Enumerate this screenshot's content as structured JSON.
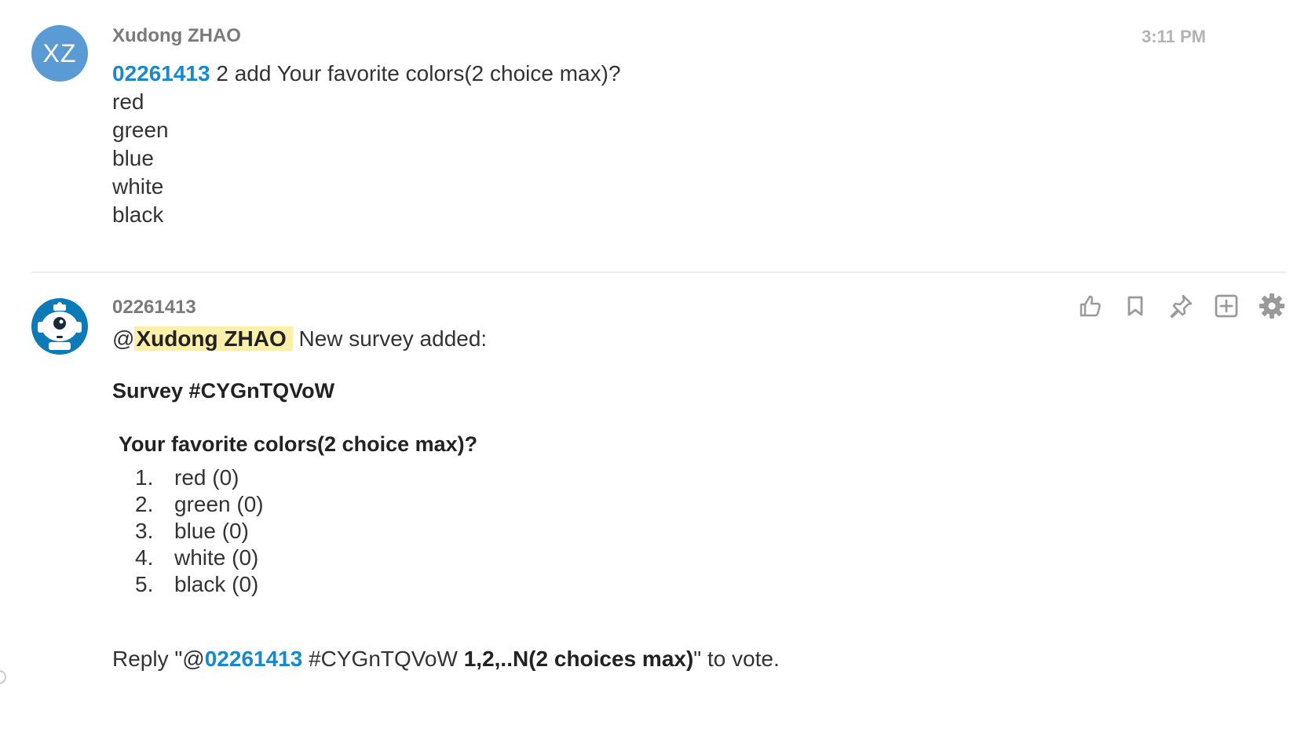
{
  "messages": [
    {
      "avatar_initials": "XZ",
      "sender": "Xudong ZHAO",
      "timestamp": "3:11 PM",
      "mention": "02261413",
      "command_text": " 2 add Your favorite colors(2 choice max)?",
      "lines": [
        "red",
        "green",
        "blue",
        "white",
        "black"
      ]
    },
    {
      "sender": "02261413",
      "reply_prefix": "@",
      "mentioned_user": "Xudong ZHAO",
      "reply_text": " New survey added:",
      "survey_id": "Survey #CYGnTQVoW",
      "question": "Your favorite colors(2 choice max)?",
      "options": [
        {
          "num": "1.",
          "label": "red (0)"
        },
        {
          "num": "2.",
          "label": "green (0)"
        },
        {
          "num": "3.",
          "label": "blue (0)"
        },
        {
          "num": "4.",
          "label": "white (0)"
        },
        {
          "num": "5.",
          "label": "black (0)"
        }
      ],
      "vote": {
        "prefix": "Reply \"@",
        "mention": "02261413",
        "survey_tag": " #CYGnTQVoW ",
        "choices": "1,2,..N(2 choices max)",
        "suffix": "\" to vote."
      }
    }
  ],
  "actions": [
    "thumbs-up-icon",
    "bookmark-icon",
    "pin-icon",
    "add-square-icon",
    "gear-icon"
  ],
  "colors": {
    "link": "#1a88c9",
    "mention_highlight": "#fbefaa",
    "avatar_xz": "#5b9bd5",
    "avatar_bot": "#0d7ab8"
  }
}
